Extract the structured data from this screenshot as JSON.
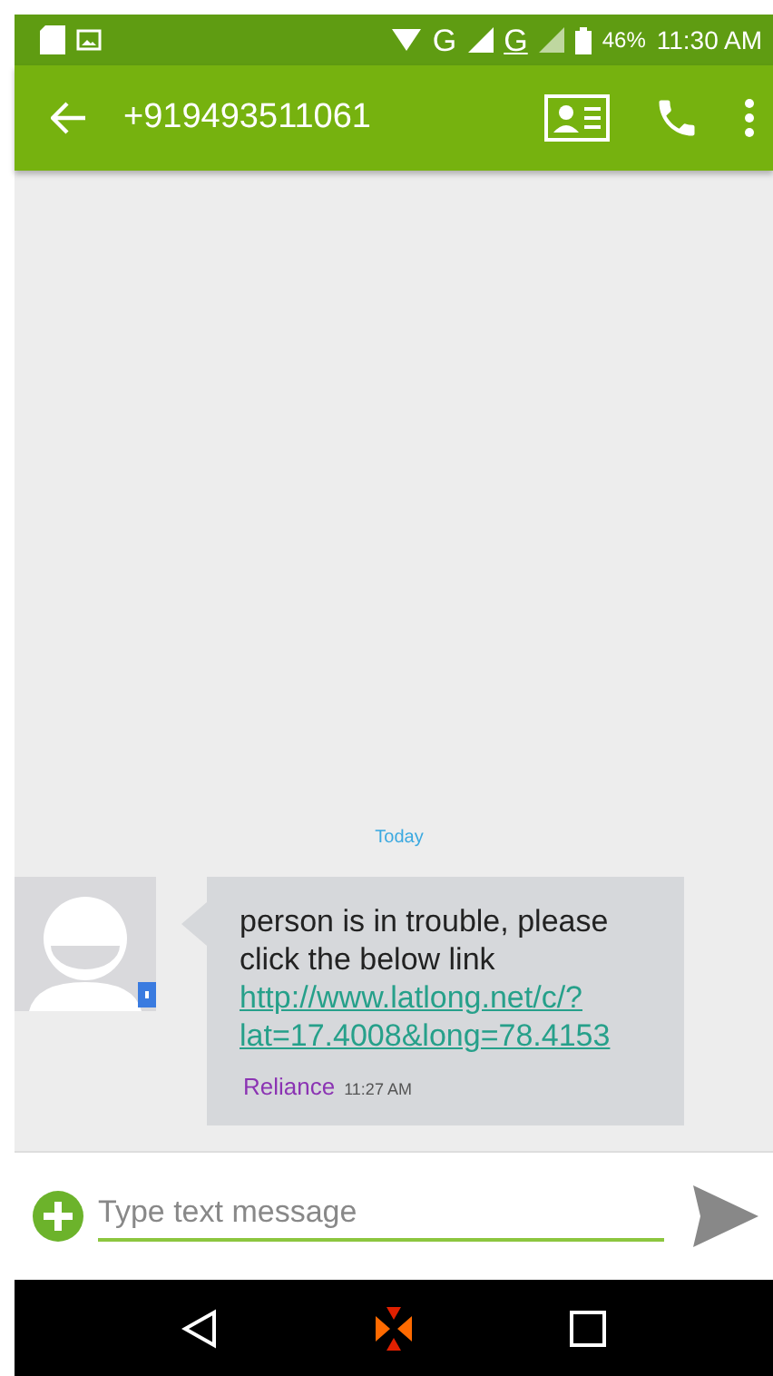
{
  "status_bar": {
    "network_labels": [
      "G",
      "G"
    ],
    "battery": "46%",
    "time": "11:30 AM"
  },
  "app_bar": {
    "title": "+919493511061"
  },
  "conversation": {
    "date_divider": "Today",
    "messages": [
      {
        "text": "person is in trouble, please click the below link",
        "link": "http://www.latlong.net/c/?lat=17.4008&long=78.4153",
        "sender": "Reliance",
        "time": "11:27 AM"
      }
    ]
  },
  "composer": {
    "placeholder": "Type text message"
  }
}
